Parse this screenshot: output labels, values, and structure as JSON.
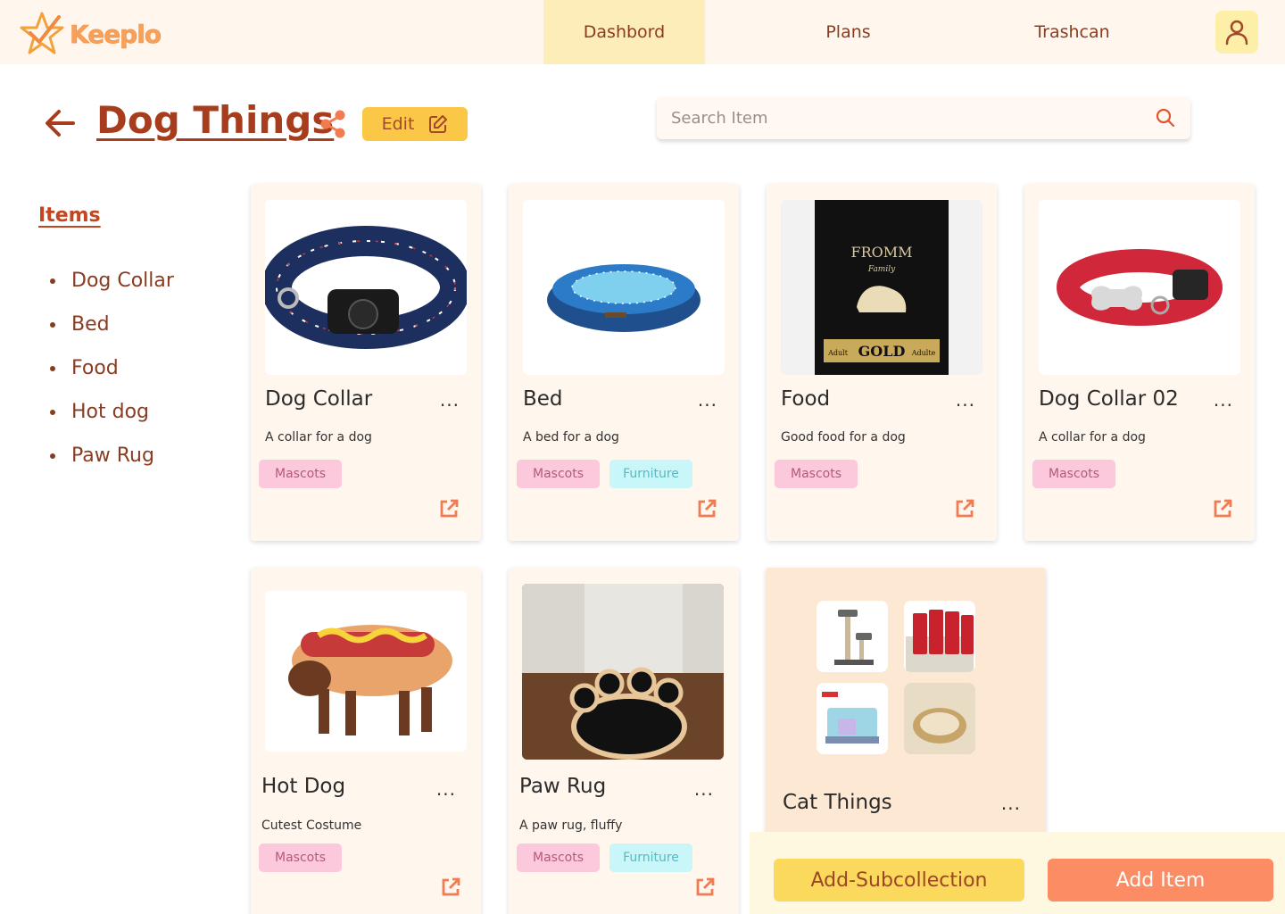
{
  "header": {
    "logo_text": "Keeplo",
    "nav": [
      {
        "label": "Dashbord",
        "active": true
      },
      {
        "label": "Plans",
        "active": false
      },
      {
        "label": "Trashcan",
        "active": false
      }
    ],
    "profile_icon": "user-icon"
  },
  "collection": {
    "title": "Dog Things",
    "edit_label": "Edit",
    "search_placeholder": "Search Item"
  },
  "sidebar": {
    "heading": "Items",
    "items": [
      "Dog Collar",
      "Bed",
      "Food",
      "Hot dog",
      "Paw Rug"
    ]
  },
  "cards": [
    {
      "name": "Dog Collar",
      "desc": "A collar for a dog",
      "tags": [
        "Mascots"
      ],
      "image": "navy-anchor-collar"
    },
    {
      "name": "Bed",
      "desc": "A bed for a dog",
      "tags": [
        "Mascots",
        "Furniture"
      ],
      "image": "blue-dog-bed"
    },
    {
      "name": "Food",
      "desc": "Good food for a dog",
      "tags": [
        "Mascots"
      ],
      "image": "dog-food-bag",
      "image_text": {
        "brand": "FROMM",
        "family": "Family",
        "gold": "GOLD",
        "adult": "Adult",
        "adulte": "Adulte"
      }
    },
    {
      "name": "Dog Collar 02",
      "desc": "A collar for a dog",
      "tags": [
        "Mascots"
      ],
      "image": "red-collar"
    },
    {
      "name": "Hot Dog",
      "desc": "Cutest Costume",
      "tags": [
        "Mascots"
      ],
      "image": "hotdog-costume"
    },
    {
      "name": "Paw Rug",
      "desc": "A paw rug, fluffy",
      "tags": [
        "Mascots",
        "Furniture"
      ],
      "image": "paw-rug"
    }
  ],
  "subcollection": {
    "name": "Cat Things",
    "thumbnails": [
      "cat-tree",
      "cat-litter-bags",
      "cat-house",
      "cat-bed"
    ]
  },
  "more_icon_label": "...",
  "actions": {
    "add_subcollection": "Add-Subcollection",
    "add_item": "Add Item"
  },
  "colors": {
    "header_bg": "#fff7ee",
    "nav_active": "#fdedb8",
    "accent_brown": "#a73d1c",
    "edit_yellow": "#fbc746",
    "tag_pink": "#fbc8dc",
    "tag_cyan": "#c9f6f8",
    "add_item_orange": "#fb8c64",
    "add_sub_yellow": "#fbd95c"
  }
}
